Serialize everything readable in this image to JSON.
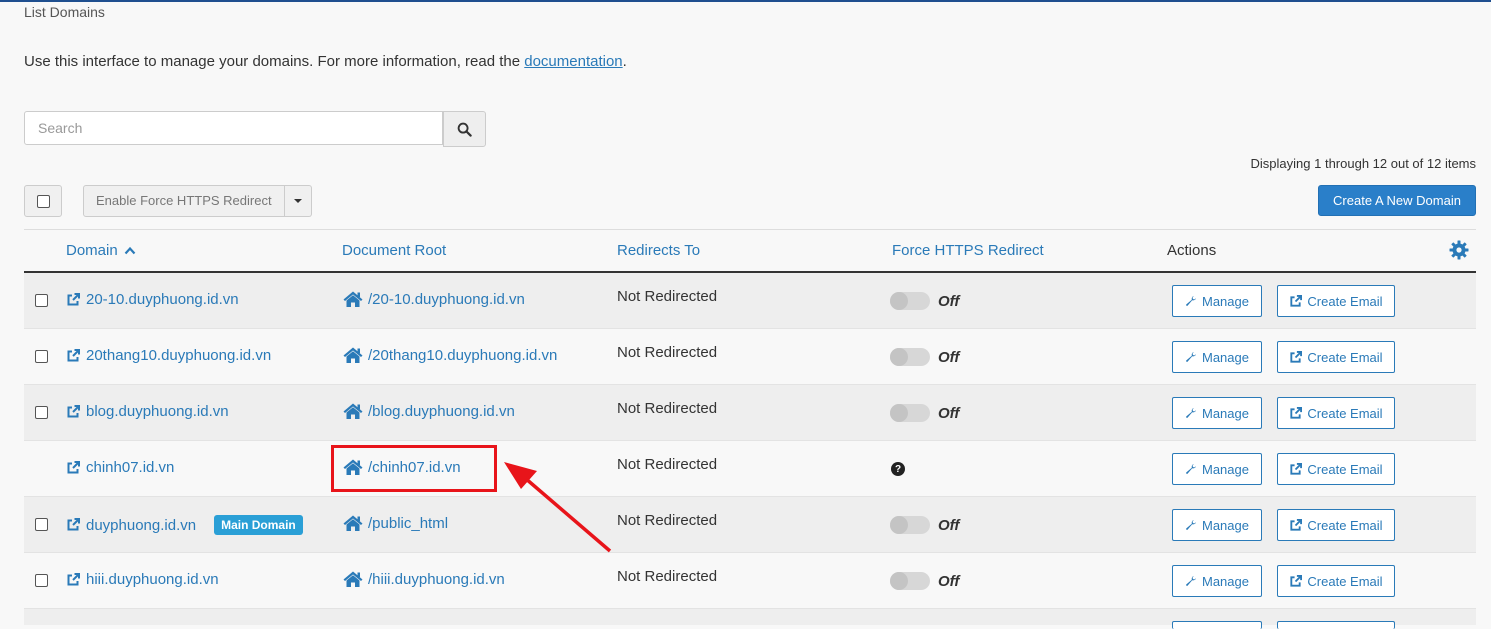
{
  "page": {
    "title": "List Domains",
    "intro_text": "Use this interface to manage your domains. For more information, read the ",
    "intro_link": "documentation",
    "intro_end": "."
  },
  "search": {
    "placeholder": "Search",
    "icon": "search-icon"
  },
  "pagination": {
    "displaying": "Displaying 1 through 12 out of 12 items"
  },
  "toolbar": {
    "bulk_action_label": "Enable Force HTTPS Redirect",
    "create_label": "Create A New Domain"
  },
  "table": {
    "headers": {
      "domain": "Domain",
      "document_root": "Document Root",
      "redirects_to": "Redirects To",
      "force_https": "Force HTTPS Redirect",
      "actions": "Actions"
    },
    "manage_label": "Manage",
    "create_email_label": "Create Email",
    "rows": [
      {
        "domain": "20-10.duyphuong.id.vn",
        "root": "/20-10.duyphuong.id.vn",
        "redirect": "Not Redirected",
        "https": "Off"
      },
      {
        "domain": "20thang10.duyphuong.id.vn",
        "root": "/20thang10.duyphuong.id.vn",
        "redirect": "Not Redirected",
        "https": "Off"
      },
      {
        "domain": "blog.duyphuong.id.vn",
        "root": "/blog.duyphuong.id.vn",
        "redirect": "Not Redirected",
        "https": "Off"
      },
      {
        "domain": "chinh07.id.vn",
        "root": "/chinh07.id.vn",
        "redirect": "Not Redirected",
        "https": "?"
      },
      {
        "domain": "duyphuong.id.vn",
        "badge": "Main Domain",
        "root": "/public_html",
        "redirect": "Not Redirected",
        "https": "Off"
      },
      {
        "domain": "hiii.duyphuong.id.vn",
        "root": "/hiii.duyphuong.id.vn",
        "redirect": "Not Redirected",
        "https": "Off"
      }
    ]
  },
  "colors": {
    "link": "#2a7ab8",
    "primary": "#2a7fc9",
    "badge": "#2a9fd6",
    "annotation": "#e8141a"
  }
}
